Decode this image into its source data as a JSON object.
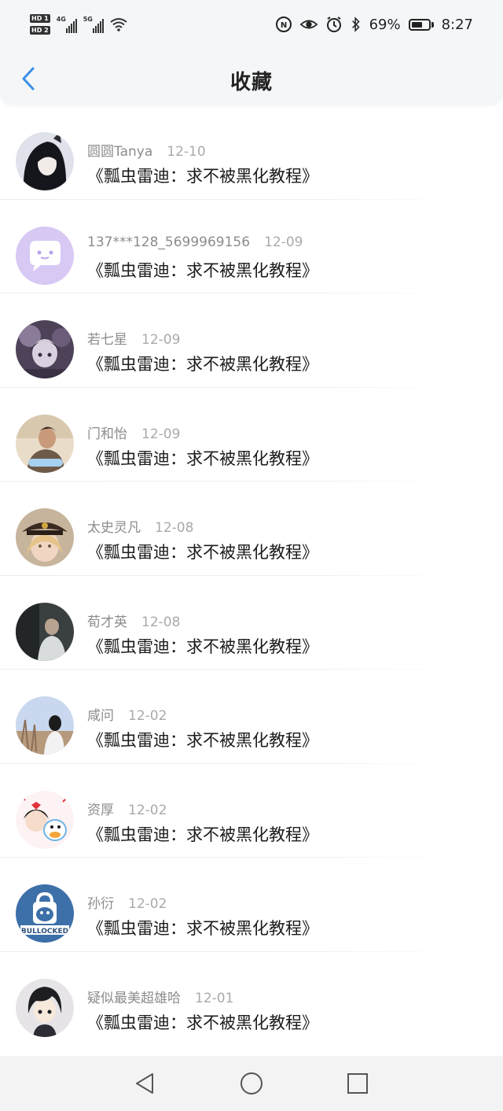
{
  "status_bar": {
    "hd1": "HD 1",
    "hd2": "HD 2",
    "sim1_gen": "4G",
    "sim2_gen": "5G",
    "battery_text": "69%",
    "battery_level": 0.69,
    "time": "8:27",
    "icons": [
      "nfc-icon",
      "eye-icon",
      "alarm-icon",
      "bluetooth-icon",
      "battery-icon"
    ]
  },
  "header": {
    "title": "收藏",
    "back_icon": "chevron-left-icon",
    "accent_color": "#3a8ee6"
  },
  "items": [
    {
      "user": "圆圆Tanya",
      "date": "12-10",
      "title": "《瓢虫雷迪：求不被黑化教程》"
    },
    {
      "user": "137***128_5699969156",
      "date": "12-09",
      "title": "《瓢虫雷迪：求不被黑化教程》"
    },
    {
      "user": "若七星",
      "date": "12-09",
      "title": "《瓢虫雷迪：求不被黑化教程》"
    },
    {
      "user": "门和怡",
      "date": "12-09",
      "title": "《瓢虫雷迪：求不被黑化教程》"
    },
    {
      "user": "太史灵凡",
      "date": "12-08",
      "title": "《瓢虫雷迪：求不被黑化教程》"
    },
    {
      "user": "荀才英",
      "date": "12-08",
      "title": "《瓢虫雷迪：求不被黑化教程》"
    },
    {
      "user": "咸问",
      "date": "12-02",
      "title": "《瓢虫雷迪：求不被黑化教程》"
    },
    {
      "user": "资厚",
      "date": "12-02",
      "title": "《瓢虫雷迪：求不被黑化教程》"
    },
    {
      "user": "孙衍",
      "date": "12-02",
      "title": "《瓢虫雷迪：求不被黑化教程》"
    },
    {
      "user": "疑似最美超雄哈",
      "date": "12-01",
      "title": "《瓢虫雷迪：求不被黑化教程》"
    }
  ],
  "avatar_badge_text": "BULLOCKED",
  "system_nav": [
    "back-triangle-icon",
    "home-circle-icon",
    "recents-square-icon"
  ]
}
